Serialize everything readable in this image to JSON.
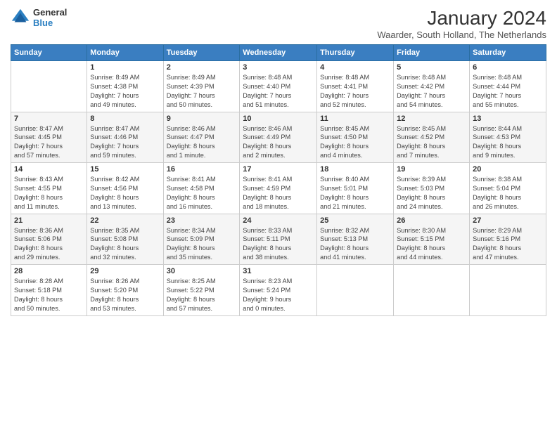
{
  "logo": {
    "general": "General",
    "blue": "Blue"
  },
  "title": "January 2024",
  "location": "Waarder, South Holland, The Netherlands",
  "weekdays": [
    "Sunday",
    "Monday",
    "Tuesday",
    "Wednesday",
    "Thursday",
    "Friday",
    "Saturday"
  ],
  "weeks": [
    [
      {
        "day": "",
        "info": ""
      },
      {
        "day": "1",
        "info": "Sunrise: 8:49 AM\nSunset: 4:38 PM\nDaylight: 7 hours\nand 49 minutes."
      },
      {
        "day": "2",
        "info": "Sunrise: 8:49 AM\nSunset: 4:39 PM\nDaylight: 7 hours\nand 50 minutes."
      },
      {
        "day": "3",
        "info": "Sunrise: 8:48 AM\nSunset: 4:40 PM\nDaylight: 7 hours\nand 51 minutes."
      },
      {
        "day": "4",
        "info": "Sunrise: 8:48 AM\nSunset: 4:41 PM\nDaylight: 7 hours\nand 52 minutes."
      },
      {
        "day": "5",
        "info": "Sunrise: 8:48 AM\nSunset: 4:42 PM\nDaylight: 7 hours\nand 54 minutes."
      },
      {
        "day": "6",
        "info": "Sunrise: 8:48 AM\nSunset: 4:44 PM\nDaylight: 7 hours\nand 55 minutes."
      }
    ],
    [
      {
        "day": "7",
        "info": "Sunrise: 8:47 AM\nSunset: 4:45 PM\nDaylight: 7 hours\nand 57 minutes."
      },
      {
        "day": "8",
        "info": "Sunrise: 8:47 AM\nSunset: 4:46 PM\nDaylight: 7 hours\nand 59 minutes."
      },
      {
        "day": "9",
        "info": "Sunrise: 8:46 AM\nSunset: 4:47 PM\nDaylight: 8 hours\nand 1 minute."
      },
      {
        "day": "10",
        "info": "Sunrise: 8:46 AM\nSunset: 4:49 PM\nDaylight: 8 hours\nand 2 minutes."
      },
      {
        "day": "11",
        "info": "Sunrise: 8:45 AM\nSunset: 4:50 PM\nDaylight: 8 hours\nand 4 minutes."
      },
      {
        "day": "12",
        "info": "Sunrise: 8:45 AM\nSunset: 4:52 PM\nDaylight: 8 hours\nand 7 minutes."
      },
      {
        "day": "13",
        "info": "Sunrise: 8:44 AM\nSunset: 4:53 PM\nDaylight: 8 hours\nand 9 minutes."
      }
    ],
    [
      {
        "day": "14",
        "info": "Sunrise: 8:43 AM\nSunset: 4:55 PM\nDaylight: 8 hours\nand 11 minutes."
      },
      {
        "day": "15",
        "info": "Sunrise: 8:42 AM\nSunset: 4:56 PM\nDaylight: 8 hours\nand 13 minutes."
      },
      {
        "day": "16",
        "info": "Sunrise: 8:41 AM\nSunset: 4:58 PM\nDaylight: 8 hours\nand 16 minutes."
      },
      {
        "day": "17",
        "info": "Sunrise: 8:41 AM\nSunset: 4:59 PM\nDaylight: 8 hours\nand 18 minutes."
      },
      {
        "day": "18",
        "info": "Sunrise: 8:40 AM\nSunset: 5:01 PM\nDaylight: 8 hours\nand 21 minutes."
      },
      {
        "day": "19",
        "info": "Sunrise: 8:39 AM\nSunset: 5:03 PM\nDaylight: 8 hours\nand 24 minutes."
      },
      {
        "day": "20",
        "info": "Sunrise: 8:38 AM\nSunset: 5:04 PM\nDaylight: 8 hours\nand 26 minutes."
      }
    ],
    [
      {
        "day": "21",
        "info": "Sunrise: 8:36 AM\nSunset: 5:06 PM\nDaylight: 8 hours\nand 29 minutes."
      },
      {
        "day": "22",
        "info": "Sunrise: 8:35 AM\nSunset: 5:08 PM\nDaylight: 8 hours\nand 32 minutes."
      },
      {
        "day": "23",
        "info": "Sunrise: 8:34 AM\nSunset: 5:09 PM\nDaylight: 8 hours\nand 35 minutes."
      },
      {
        "day": "24",
        "info": "Sunrise: 8:33 AM\nSunset: 5:11 PM\nDaylight: 8 hours\nand 38 minutes."
      },
      {
        "day": "25",
        "info": "Sunrise: 8:32 AM\nSunset: 5:13 PM\nDaylight: 8 hours\nand 41 minutes."
      },
      {
        "day": "26",
        "info": "Sunrise: 8:30 AM\nSunset: 5:15 PM\nDaylight: 8 hours\nand 44 minutes."
      },
      {
        "day": "27",
        "info": "Sunrise: 8:29 AM\nSunset: 5:16 PM\nDaylight: 8 hours\nand 47 minutes."
      }
    ],
    [
      {
        "day": "28",
        "info": "Sunrise: 8:28 AM\nSunset: 5:18 PM\nDaylight: 8 hours\nand 50 minutes."
      },
      {
        "day": "29",
        "info": "Sunrise: 8:26 AM\nSunset: 5:20 PM\nDaylight: 8 hours\nand 53 minutes."
      },
      {
        "day": "30",
        "info": "Sunrise: 8:25 AM\nSunset: 5:22 PM\nDaylight: 8 hours\nand 57 minutes."
      },
      {
        "day": "31",
        "info": "Sunrise: 8:23 AM\nSunset: 5:24 PM\nDaylight: 9 hours\nand 0 minutes."
      },
      {
        "day": "",
        "info": ""
      },
      {
        "day": "",
        "info": ""
      },
      {
        "day": "",
        "info": ""
      }
    ]
  ]
}
